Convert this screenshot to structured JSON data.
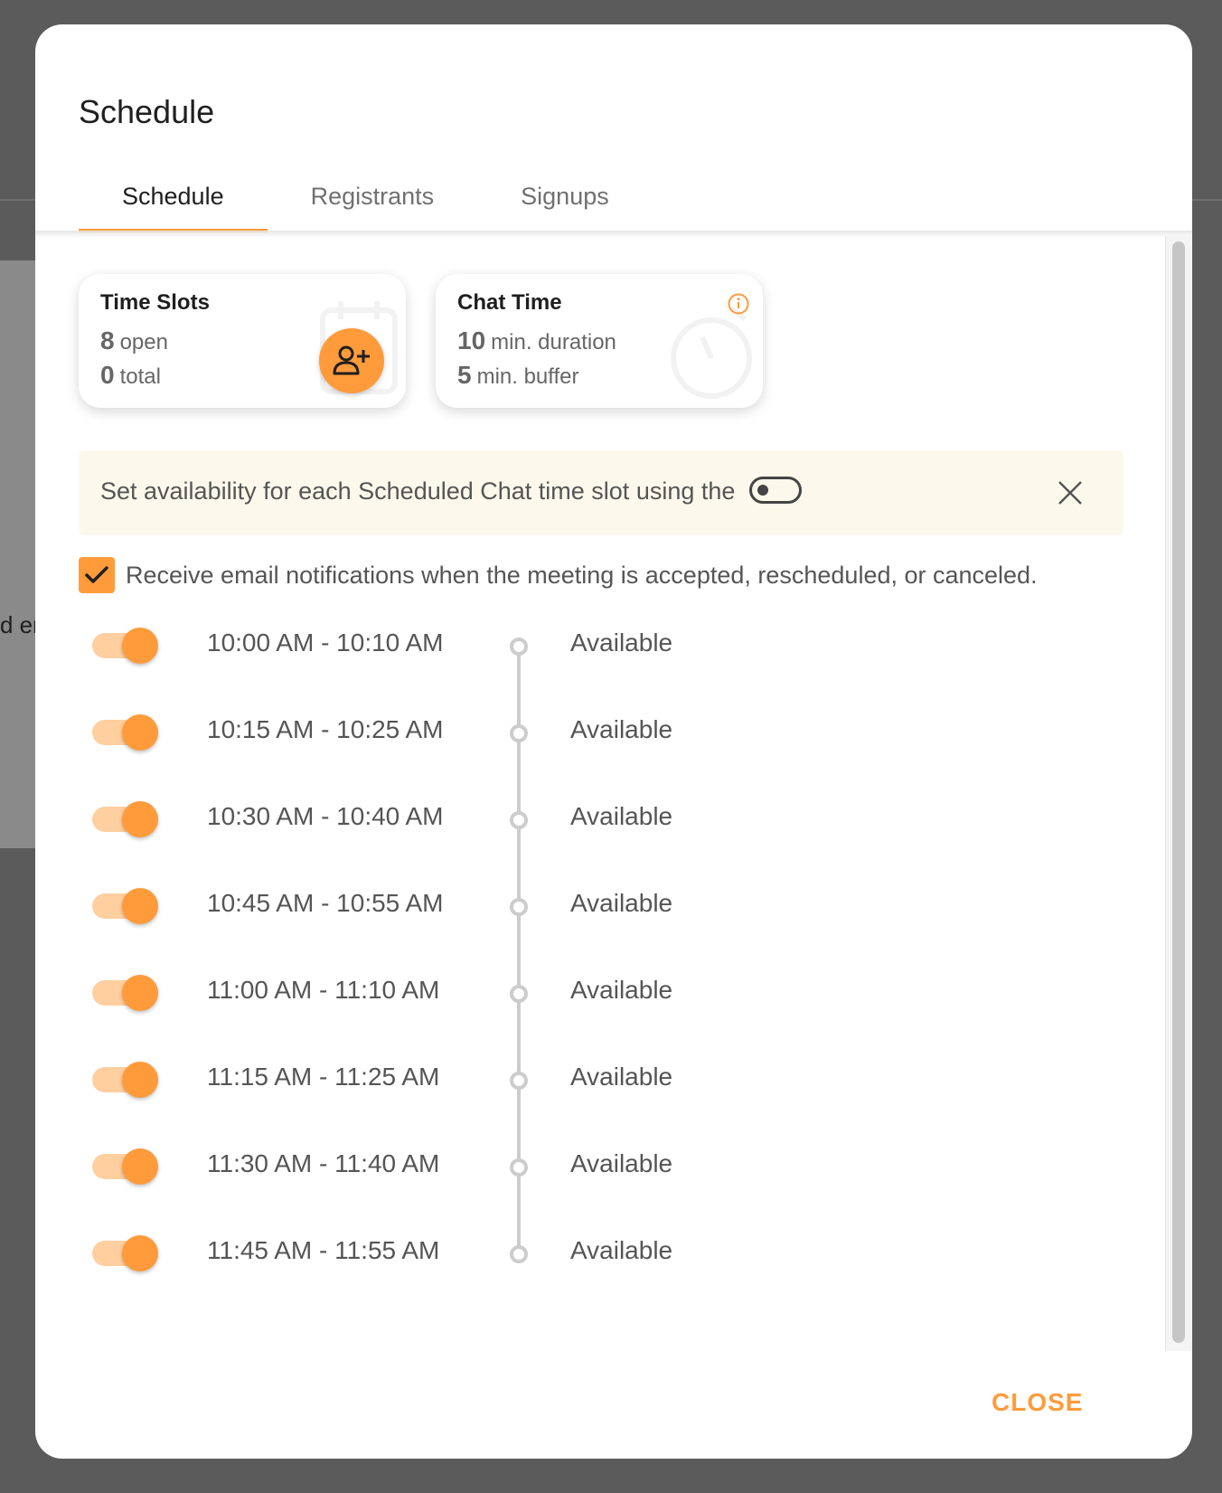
{
  "dialog": {
    "title": "Schedule",
    "close_label": "CLOSE"
  },
  "tabs": [
    {
      "label": "Schedule",
      "active": true
    },
    {
      "label": "Registrants",
      "active": false
    },
    {
      "label": "Signups",
      "active": false
    }
  ],
  "time_slots_card": {
    "title": "Time Slots",
    "open_count": "8",
    "open_label": "open",
    "total_count": "0",
    "total_label": "total",
    "icon": "add-user-icon"
  },
  "chat_time_card": {
    "title": "Chat Time",
    "duration_value": "10",
    "duration_label": "min. duration",
    "buffer_value": "5",
    "buffer_label": "min. buffer",
    "icon": "info-icon"
  },
  "banner": {
    "text": "Set availability for each Scheduled Chat time slot using the",
    "icon": "toggle-icon"
  },
  "email_notifications": {
    "checked": true,
    "label": "Receive email notifications when the meeting is accepted, rescheduled, or canceled."
  },
  "slots": [
    {
      "time": "10:00 AM - 10:10 AM",
      "status": "Available",
      "enabled": true
    },
    {
      "time": "10:15 AM - 10:25 AM",
      "status": "Available",
      "enabled": true
    },
    {
      "time": "10:30 AM - 10:40 AM",
      "status": "Available",
      "enabled": true
    },
    {
      "time": "10:45 AM - 10:55 AM",
      "status": "Available",
      "enabled": true
    },
    {
      "time": "11:00 AM - 11:10 AM",
      "status": "Available",
      "enabled": true
    },
    {
      "time": "11:15 AM - 11:25 AM",
      "status": "Available",
      "enabled": true
    },
    {
      "time": "11:30 AM - 11:40 AM",
      "status": "Available",
      "enabled": true
    },
    {
      "time": "11:45 AM - 11:55 AM",
      "status": "Available",
      "enabled": true
    }
  ],
  "colors": {
    "accent": "#ff9b3b",
    "accent_light": "#ffcf9f",
    "banner_bg": "#fcf9ec"
  },
  "backdrop": {
    "partial_text": "d er"
  }
}
